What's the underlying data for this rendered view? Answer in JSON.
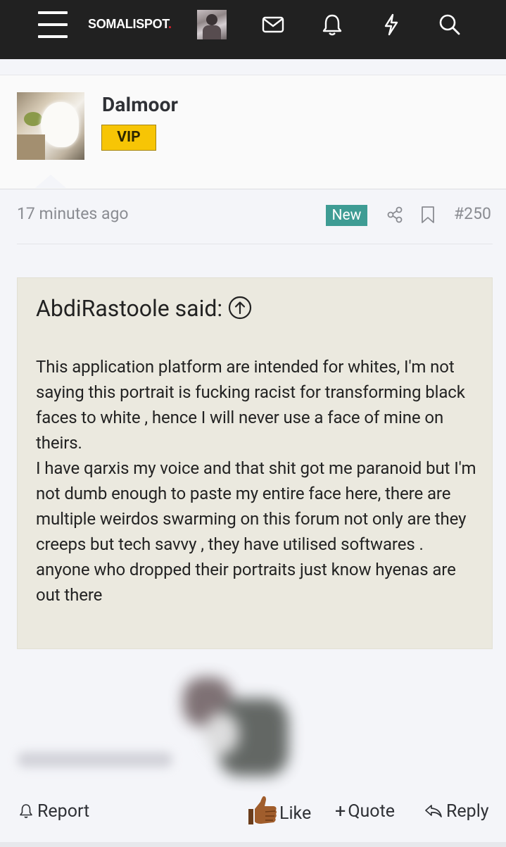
{
  "header": {
    "logo_text": "SOMALISPOT",
    "logo_dot": ".",
    "icons": [
      "menu-icon",
      "avatar",
      "envelope-icon",
      "bell-icon",
      "lightning-icon",
      "search-icon"
    ]
  },
  "author": {
    "name": "Dalmoor",
    "badge": "VIP"
  },
  "post": {
    "time": "17 minutes ago",
    "new_label": "New",
    "number": "#250",
    "quote_author": "AbdiRastoole said:",
    "quote_lines": [
      "This application platform are intended for whites, I'm not saying this portrait is fucking racist for transforming black faces to white , hence I will never use a face of mine on theirs.",
      "I have qarxis my voice and that shit got me paranoid but I'm not dumb enough to paste my entire face here, there are multiple weirdos swarming on this forum not only are they creeps but tech savvy , they have utilised softwares .",
      "anyone who dropped their portraits just know hyenas are out there"
    ]
  },
  "actions": {
    "report": "Report",
    "like": "Like",
    "quote": "Quote",
    "reply": "Reply"
  },
  "colors": {
    "topbar": "#212121",
    "badge_vip": "#f7c505",
    "badge_new": "#3e9c94",
    "quote_bg": "#ebe9df",
    "logo_dot": "#e4202e"
  }
}
